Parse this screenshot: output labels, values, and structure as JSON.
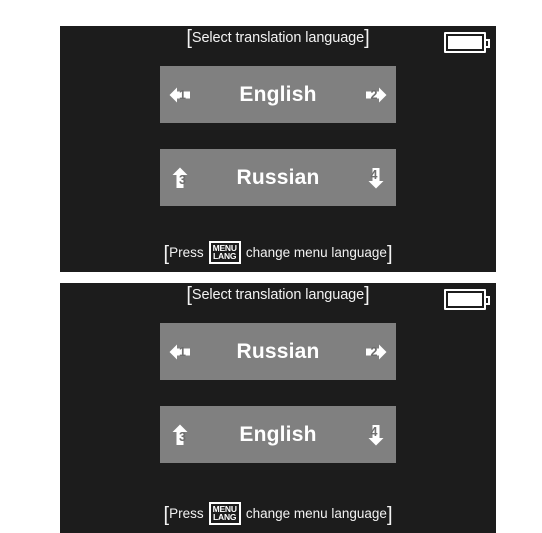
{
  "screens": [
    {
      "id": "screen-top",
      "header": {
        "title": "[Select translation language]",
        "title_open_bracket": "[",
        "title_text": "Select translation language",
        "title_close_bracket": "]",
        "battery_icon": "battery-full-icon"
      },
      "options": [
        {
          "label": "English",
          "left_key": "1",
          "right_key": "2",
          "left_icon": "arrow-left-icon",
          "right_icon": "arrow-right-icon"
        },
        {
          "label": "Russian",
          "left_key": "3",
          "right_key": "4",
          "left_icon": "arrow-up-icon",
          "right_icon": "arrow-down-icon"
        }
      ],
      "footer": {
        "open_bracket": "[",
        "prefix": "Press",
        "badge_line1": "MENU",
        "badge_line2": "LANG",
        "suffix": "change menu language",
        "close_bracket": "]"
      }
    },
    {
      "id": "screen-bottom",
      "header": {
        "title": "[Select translation language]",
        "title_open_bracket": "[",
        "title_text": "Select translation language",
        "title_close_bracket": "]",
        "battery_icon": "battery-full-icon"
      },
      "options": [
        {
          "label": "Russian",
          "left_key": "1",
          "right_key": "2",
          "left_icon": "arrow-left-icon",
          "right_icon": "arrow-right-icon"
        },
        {
          "label": "English",
          "left_key": "3",
          "right_key": "4",
          "left_icon": "arrow-up-icon",
          "right_icon": "arrow-down-icon"
        }
      ],
      "footer": {
        "open_bracket": "[",
        "prefix": "Press",
        "badge_line1": "MENU",
        "badge_line2": "LANG",
        "suffix": "change menu language",
        "close_bracket": "]"
      }
    }
  ],
  "colors": {
    "screen_background": "#1c1c1c",
    "option_background": "#808080",
    "text": "#f2f2f2",
    "key_glyph": "#ffffff",
    "key_number": "#6e6e6e",
    "page_background": "#ffffff"
  }
}
